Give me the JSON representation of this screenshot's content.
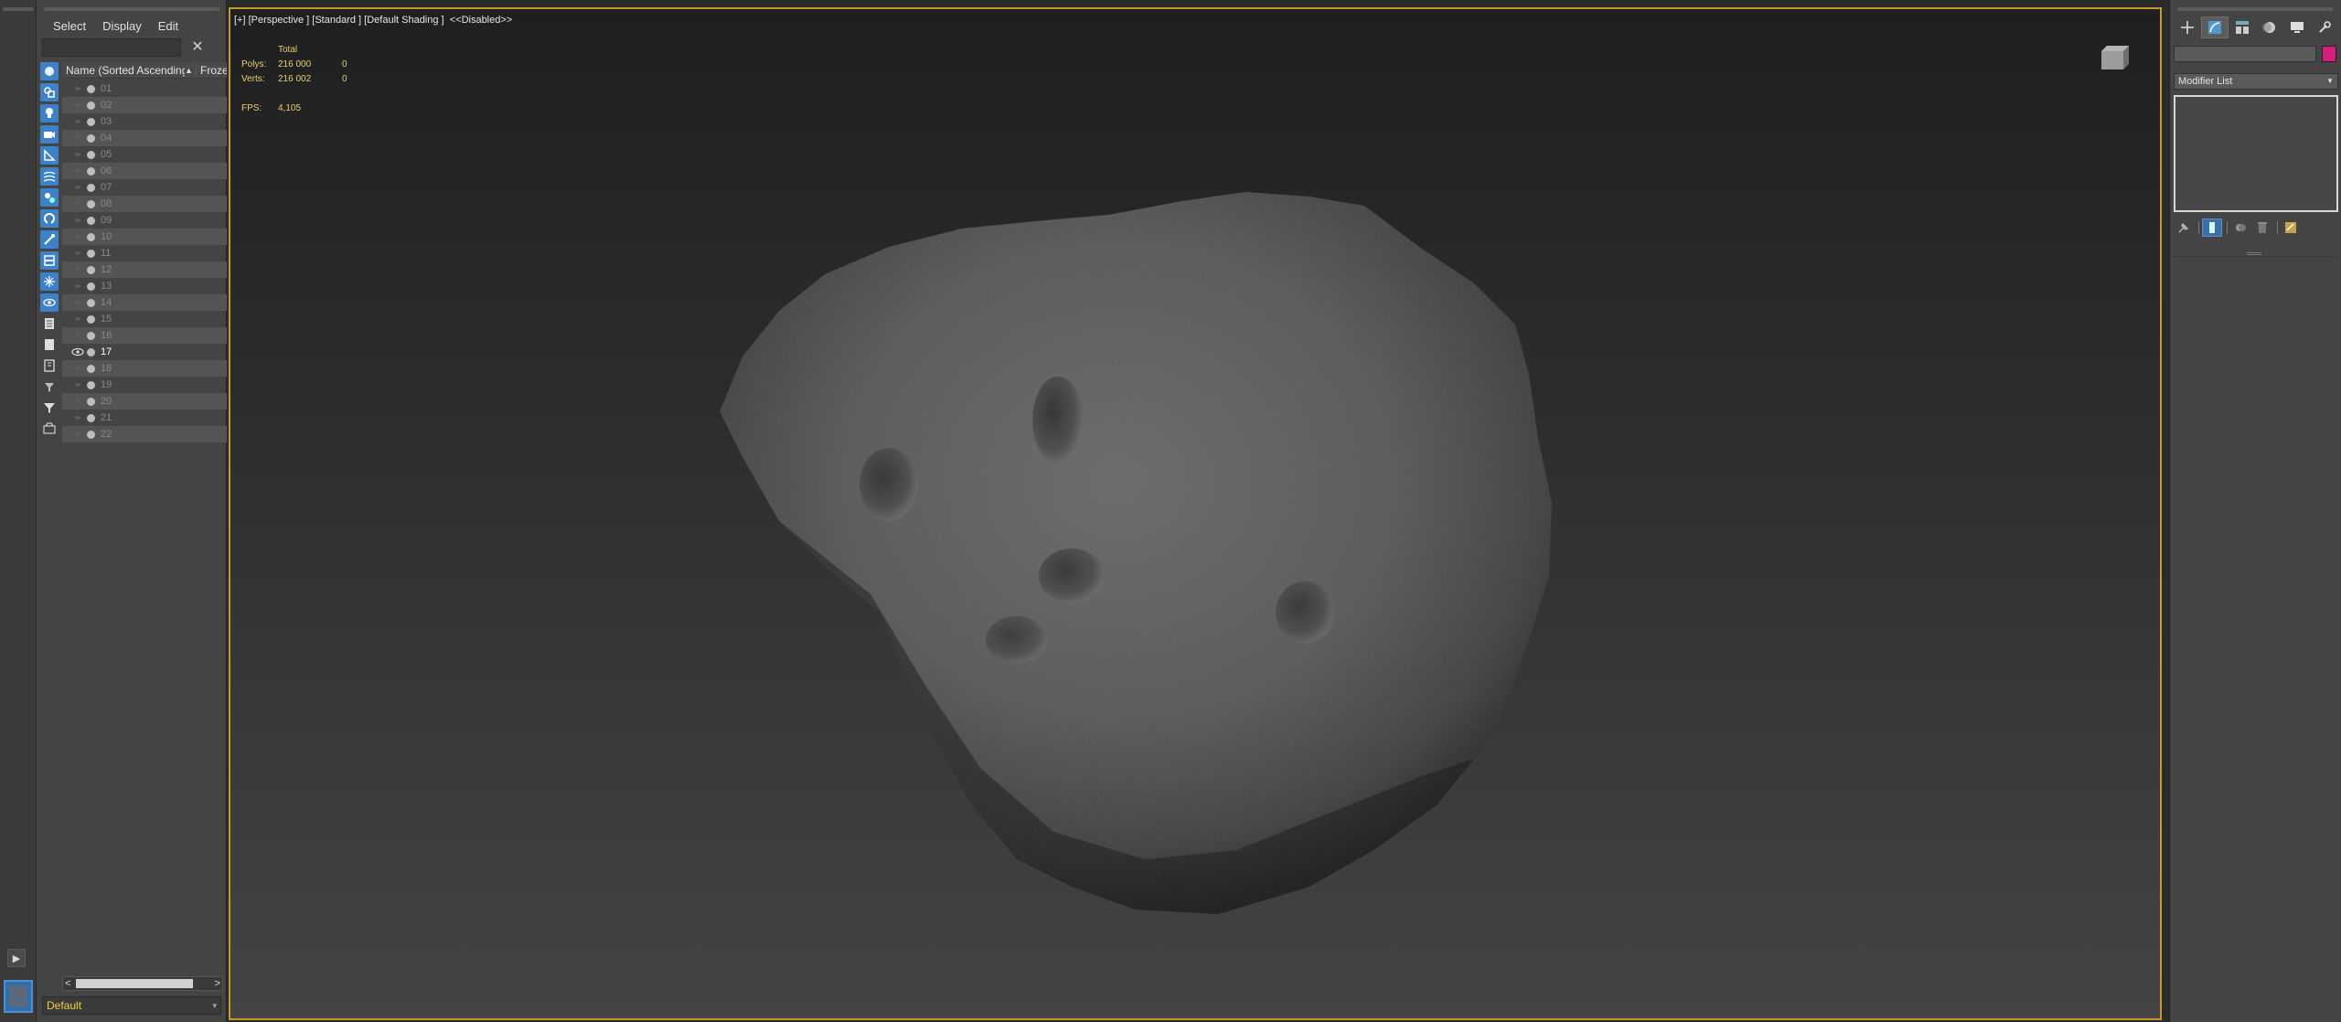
{
  "explorer": {
    "menu": [
      "Select",
      "Display",
      "Edit"
    ],
    "search": {
      "value": "",
      "placeholder": ""
    },
    "columns": {
      "name": "Name (Sorted Ascending)",
      "sort_indicator": "▲",
      "frozen": "Froze"
    },
    "rows": [
      "01",
      "02",
      "03",
      "04",
      "05",
      "06",
      "07",
      "08",
      "09",
      "10",
      "11",
      "12",
      "13",
      "14",
      "15",
      "16",
      "17",
      "18",
      "19",
      "20",
      "21",
      "22"
    ],
    "active_row": "17",
    "layer": "Default"
  },
  "viewport": {
    "label": "[+] [Perspective ] [Standard ] [Default Shading ]  <<Disabled>>",
    "stats": {
      "header": "Total",
      "polys_label": "Polys:",
      "polys_total": "216 000",
      "polys_sel": "0",
      "verts_label": "Verts:",
      "verts_total": "216 002",
      "verts_sel": "0",
      "fps_label": "FPS:",
      "fps_value": "4,105"
    },
    "border_color": "#c69a2a"
  },
  "command_panel": {
    "modifier_list": "Modifier List",
    "object_color": "#d61f7b",
    "active_tab": "modify"
  },
  "icons": {
    "left_tools": [
      "geometry-filter-icon",
      "shape-filter-icon",
      "light-filter-icon",
      "camera-filter-icon",
      "helper-filter-icon",
      "spacewarp-filter-icon",
      "group-filter-icon",
      "xref-filter-icon",
      "bone-filter-icon",
      "container-filter-icon",
      "frozen-filter-icon",
      "hidden-filter-icon",
      "display-all-icon",
      "display-none-icon",
      "invert-display-icon",
      "layer-filter-icon",
      "filter-icon",
      "scene-explorer-icon"
    ]
  }
}
